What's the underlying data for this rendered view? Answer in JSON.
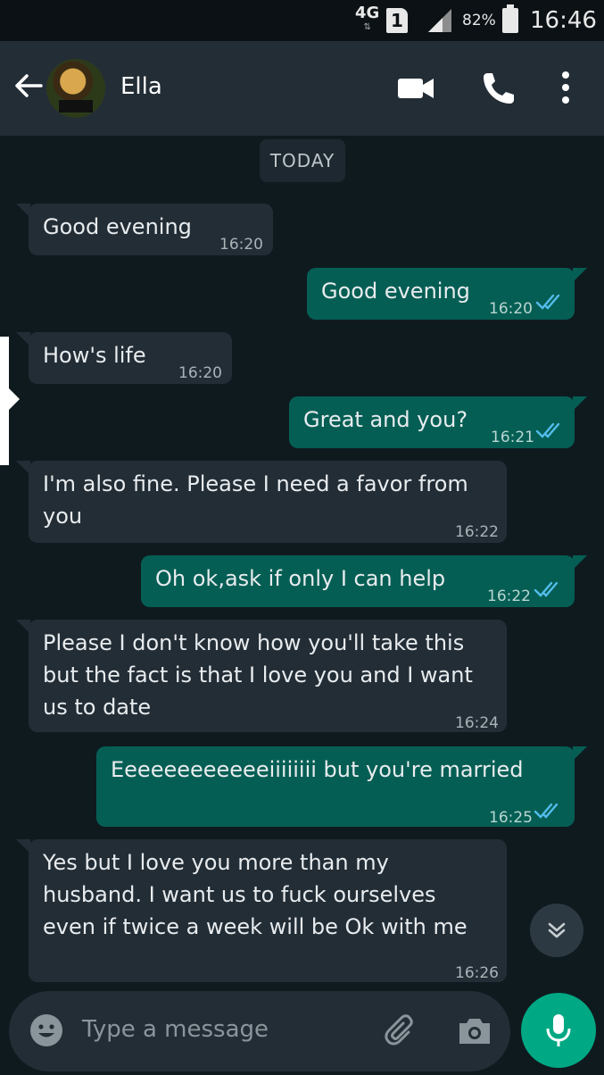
{
  "status_bar": {
    "network": "4G",
    "network_arrows": "⇅",
    "sim": "1",
    "battery_percent": "82%",
    "time": "16:46"
  },
  "header": {
    "contact_name": "Ella",
    "icons": [
      "back-arrow-icon",
      "video-icon",
      "call-icon",
      "menu-icon"
    ]
  },
  "chat": {
    "date_label": "TODAY",
    "messages": [
      {
        "dir": "in",
        "text": "Good evening",
        "time": "16:20"
      },
      {
        "dir": "out",
        "text": "Good evening",
        "time": "16:20",
        "status": "read"
      },
      {
        "dir": "in",
        "text": "How's life",
        "time": "16:20"
      },
      {
        "dir": "out",
        "text": "Great and you?",
        "time": "16:21",
        "status": "read"
      },
      {
        "dir": "in",
        "text": "I'm also fine. Please I need a favor from you",
        "time": "16:22"
      },
      {
        "dir": "out",
        "text": "Oh ok,ask if only I can help",
        "time": "16:22",
        "status": "read"
      },
      {
        "dir": "in",
        "text": "Please I don't know how you'll take this but the fact is that I love you and I want us to date",
        "time": "16:24"
      },
      {
        "dir": "out",
        "text": "Eeeeeeeeeeeeiiiiiiii but you're married",
        "time": "16:25",
        "status": "read"
      },
      {
        "dir": "in",
        "text": "Yes but I love you more than my husband.  I want us to fuck ourselves even if twice a week will be Ok with me",
        "time": "16:26"
      }
    ]
  },
  "input": {
    "placeholder": "Type a message"
  },
  "colors": {
    "background": "#0f1a1f",
    "incoming_bubble": "#232d36",
    "outgoing_bubble": "#055e54",
    "read_ticks": "#53bdeb",
    "mic_button": "#00a884"
  }
}
